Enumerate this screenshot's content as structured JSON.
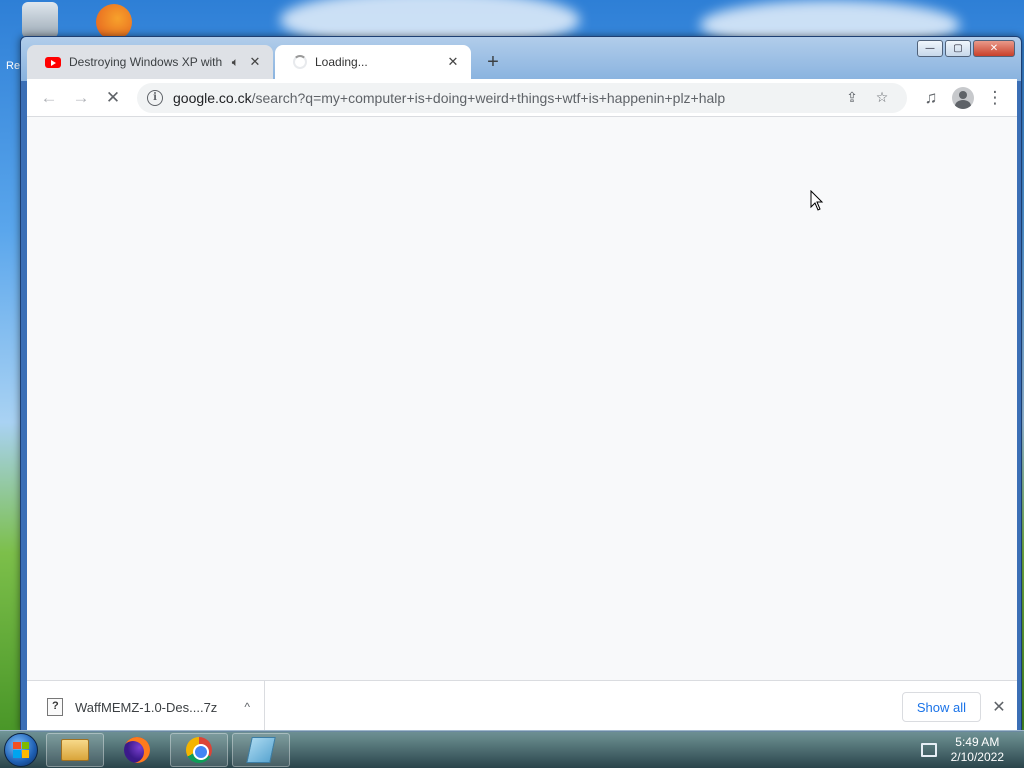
{
  "desktop": {
    "recycle_label": "Re"
  },
  "window": {
    "controls": {
      "minimize": "—",
      "maximize": "▢",
      "close": "✕"
    }
  },
  "tabs": [
    {
      "title": "Destroying Windows XP with",
      "icon": "youtube-icon",
      "audio_icon": "speaker-icon",
      "close": "✕"
    },
    {
      "title": "Loading...",
      "icon": "loading-spinner-icon",
      "close": "✕"
    }
  ],
  "new_tab": "+",
  "toolbar": {
    "back": "←",
    "forward": "→",
    "stop": "✕",
    "url_host": "google.co.ck",
    "url_path": "/search?q=my+computer+is+doing+weird+things+wtf+is+happenin+plz+halp",
    "share": "⇪",
    "star": "☆",
    "media": "♫",
    "menu": "⋮"
  },
  "download": {
    "filename": "WaffMEMZ-1.0-Des....7z",
    "chevron": "^",
    "show_all": "Show all",
    "close": "✕"
  },
  "taskbar": {
    "time": "5:49 AM",
    "date": "2/10/2022"
  },
  "colors": {
    "accent": "#1a73e8",
    "content_bg": "#f8f9fa"
  }
}
